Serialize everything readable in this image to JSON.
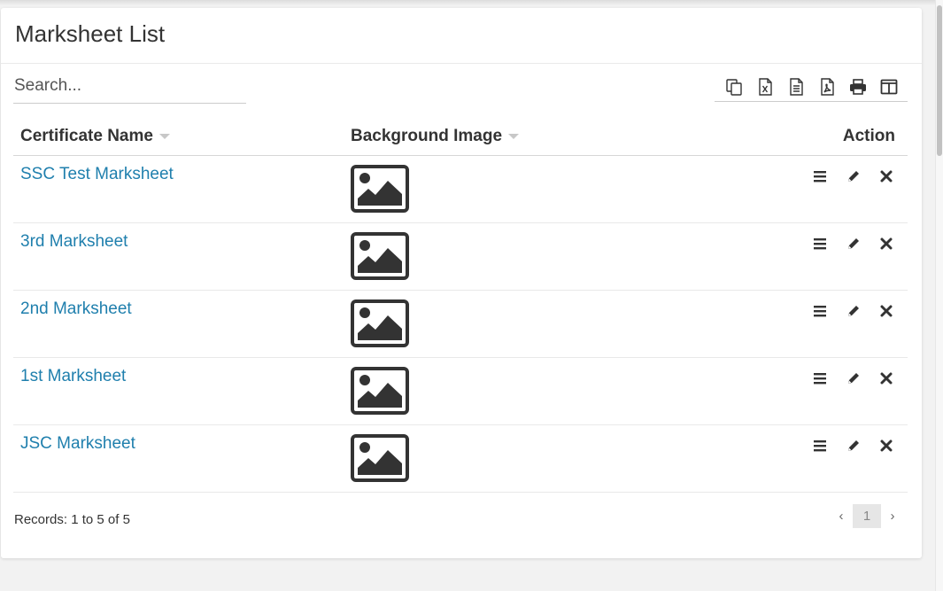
{
  "page": {
    "title": "Marksheet List"
  },
  "search": {
    "placeholder": "Search..."
  },
  "toolbar": {
    "buttons": [
      {
        "icon": "copy-icon"
      },
      {
        "icon": "excel-icon"
      },
      {
        "icon": "csv-icon"
      },
      {
        "icon": "pdf-icon"
      },
      {
        "icon": "print-icon"
      },
      {
        "icon": "columns-icon"
      }
    ]
  },
  "table": {
    "columns": [
      "Certificate Name",
      "Background Image",
      "Action"
    ],
    "rows": [
      {
        "name": "SSC Test Marksheet",
        "image": "image-placeholder-icon"
      },
      {
        "name": "3rd Marksheet",
        "image": "image-placeholder-icon"
      },
      {
        "name": "2nd Marksheet",
        "image": "image-placeholder-icon"
      },
      {
        "name": "1st Marksheet",
        "image": "image-placeholder-icon"
      },
      {
        "name": "JSC Marksheet",
        "image": "image-placeholder-icon"
      }
    ],
    "row_actions": [
      "menu-icon",
      "pencil-icon",
      "close-icon"
    ]
  },
  "footer": {
    "records": "Records: 1 to 5 of 5",
    "pager": {
      "prev": "‹",
      "current": "1",
      "next": "›"
    }
  },
  "colors": {
    "link": "#1f7fad",
    "text": "#333333",
    "background": "#f2f2f2"
  }
}
